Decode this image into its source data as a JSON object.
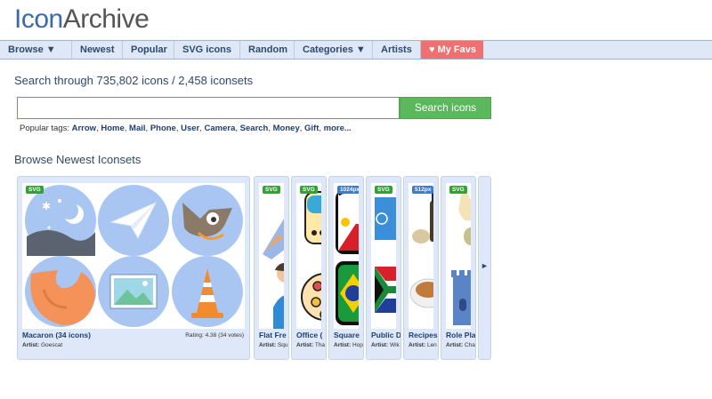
{
  "logo": {
    "part1": "Icon",
    "part2": "Archive"
  },
  "nav": {
    "browse": "Browse ▼",
    "newest": "Newest",
    "popular": "Popular",
    "svg_icons": "SVG icons",
    "random": "Random",
    "categories": "Categories ▼",
    "artists": "Artists",
    "my_favs": "♥ My Favs"
  },
  "search": {
    "heading": "Search through 735,802 icons / 2,458 iconsets",
    "placeholder": "",
    "value": "",
    "button": "Search icons"
  },
  "popular_tags": {
    "label": "Popular tags:",
    "tags": [
      "Arrow",
      "Home",
      "Mail",
      "Phone",
      "User",
      "Camera",
      "Search",
      "Money",
      "Gift"
    ],
    "more": "more..."
  },
  "browse": {
    "heading": "Browse Newest Iconsets",
    "next_label": "►",
    "iconsets": [
      {
        "title": "Macaron (34 icons)",
        "artist_label": "Artist:",
        "artist": "Goescat",
        "rating": "Rating: 4.38 (34 votes)",
        "badge": "SVG",
        "badge_type": "svg"
      },
      {
        "title": "Flat Fre",
        "artist_label": "Artist:",
        "artist": "Squ",
        "badge": "SVG",
        "badge_type": "svg"
      },
      {
        "title": "Office (",
        "artist_label": "Artist:",
        "artist": "Tha",
        "badge": "SVG",
        "badge_type": "svg"
      },
      {
        "title": "Square",
        "artist_label": "Artist:",
        "artist": "Hop",
        "badge": "1024px",
        "badge_type": "px"
      },
      {
        "title": "Public D",
        "artist_label": "Artist:",
        "artist": "Wik",
        "badge": "SVG",
        "badge_type": "svg"
      },
      {
        "title": "Recipes",
        "artist_label": "Artist:",
        "artist": "Len",
        "badge": "512px",
        "badge_type": "px"
      },
      {
        "title": "Role Pla",
        "artist_label": "Artist:",
        "artist": "Cha",
        "badge": "SVG",
        "badge_type": "svg"
      }
    ]
  },
  "colors": {
    "brand_blue": "#3a6aa8",
    "nav_bg": "#dfe8f6",
    "fav_red": "#f07070",
    "search_green": "#5cb85c",
    "macaron_circle": "#a9c6f2"
  }
}
